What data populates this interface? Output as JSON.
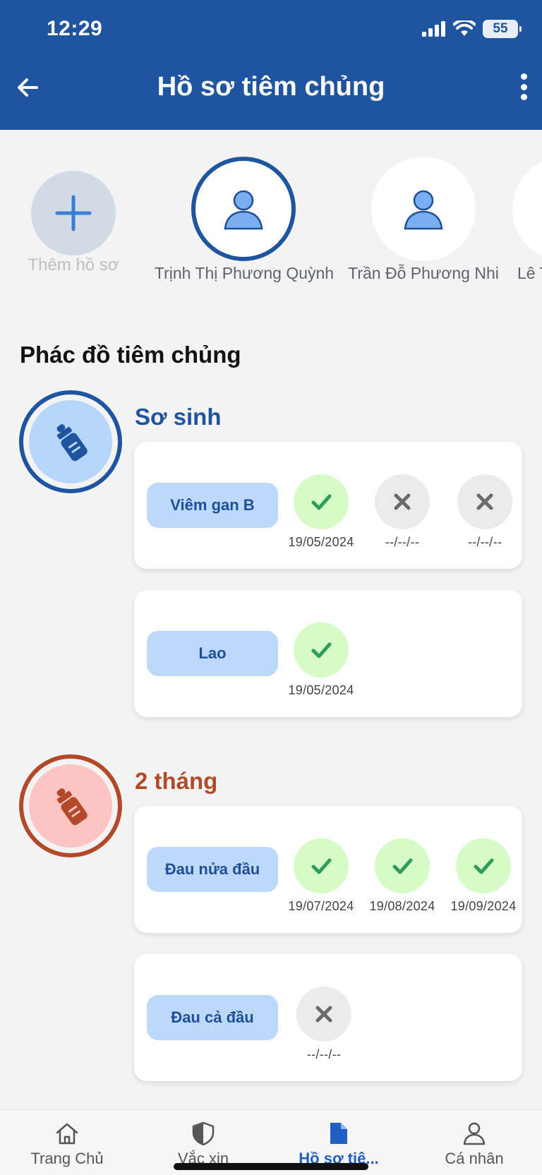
{
  "status_bar": {
    "time": "12:29",
    "battery": "55"
  },
  "header": {
    "title": "Hồ sơ tiêm chủng"
  },
  "profiles": [
    {
      "name": "Thêm hồ sơ",
      "kind": "add"
    },
    {
      "name": "Trịnh Thị Phương Quỳnh",
      "kind": "person",
      "selected": true
    },
    {
      "name": "Trần Đỗ Phương Nhi",
      "kind": "person",
      "selected": false
    },
    {
      "name": "Lê T",
      "kind": "person",
      "selected": false
    }
  ],
  "schedule": {
    "title": "Phác đồ tiêm chủng",
    "stages": [
      {
        "label": "Sơ sinh",
        "color": "#1f55a0",
        "vaccines": [
          {
            "name": "Viêm gan B",
            "doses": [
              {
                "status": "done",
                "date": "19/05/2024"
              },
              {
                "status": "missing",
                "date": "--/--/--"
              },
              {
                "status": "missing",
                "date": "--/--/--"
              }
            ]
          },
          {
            "name": "Lao",
            "doses": [
              {
                "status": "done",
                "date": "19/05/2024"
              }
            ]
          }
        ]
      },
      {
        "label": "2 tháng",
        "color": "#b24a2a",
        "vaccines": [
          {
            "name": "Đau nửa đầu",
            "doses": [
              {
                "status": "done",
                "date": "19/07/2024"
              },
              {
                "status": "done",
                "date": "19/08/2024"
              },
              {
                "status": "done",
                "date": "19/09/2024"
              }
            ]
          },
          {
            "name": "Đau cả đầu",
            "doses": [
              {
                "status": "missing",
                "date": "--/--/--"
              }
            ]
          }
        ]
      }
    ]
  },
  "bottom_nav": [
    {
      "label": "Trang Chủ",
      "icon": "home-icon",
      "active": false
    },
    {
      "label": "Vắc xin",
      "icon": "shield-icon",
      "active": false
    },
    {
      "label": "Hồ sơ tiê...",
      "icon": "document-icon",
      "active": true
    },
    {
      "label": "Cá nhân",
      "icon": "person-icon",
      "active": false
    }
  ],
  "colors": {
    "primary": "#1f55a0",
    "accent_red": "#b24a2a",
    "done_bg": "#d7fbc6",
    "check": "#2e9d5a"
  }
}
